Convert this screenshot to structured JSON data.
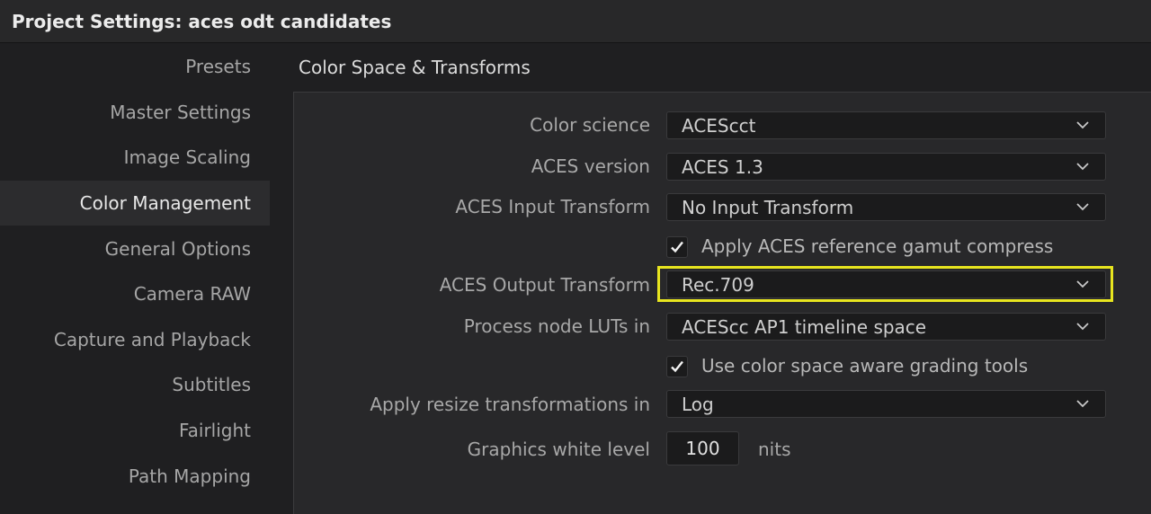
{
  "window": {
    "title": "Project Settings:  aces odt candidates"
  },
  "sidebar": {
    "items": [
      {
        "label": "Presets",
        "active": false
      },
      {
        "label": "Master Settings",
        "active": false
      },
      {
        "label": "Image Scaling",
        "active": false
      },
      {
        "label": "Color Management",
        "active": true
      },
      {
        "label": "General Options",
        "active": false
      },
      {
        "label": "Camera RAW",
        "active": false
      },
      {
        "label": "Capture and Playback",
        "active": false
      },
      {
        "label": "Subtitles",
        "active": false
      },
      {
        "label": "Fairlight",
        "active": false
      },
      {
        "label": "Path Mapping",
        "active": false
      }
    ]
  },
  "main": {
    "section_title": "Color Space & Transforms",
    "fields": {
      "color_science": {
        "label": "Color science",
        "value": "ACEScct"
      },
      "aces_version": {
        "label": "ACES version",
        "value": "ACES 1.3"
      },
      "aces_input_transform": {
        "label": "ACES Input Transform",
        "value": "No Input Transform"
      },
      "gamut_compress": {
        "label": "Apply ACES reference gamut compress",
        "checked": true
      },
      "aces_output_transform": {
        "label": "ACES Output Transform",
        "value": "Rec.709",
        "highlighted": true
      },
      "process_node_luts": {
        "label": "Process node LUTs in",
        "value": "ACEScc AP1 timeline space"
      },
      "color_space_aware": {
        "label": "Use color space aware grading tools",
        "checked": true
      },
      "resize_transform": {
        "label": "Apply resize transformations in",
        "value": "Log"
      },
      "graphics_white_level": {
        "label": "Graphics white level",
        "value": "100",
        "unit": "nits"
      }
    }
  },
  "colors": {
    "background": "#1f1f21",
    "panel": "#28282a",
    "highlight_outline": "#e8e51f",
    "active_sidebar": "#2c2c2e"
  },
  "icons": {
    "dropdown": "chevron-down-icon",
    "checkbox": "checkmark-icon"
  }
}
